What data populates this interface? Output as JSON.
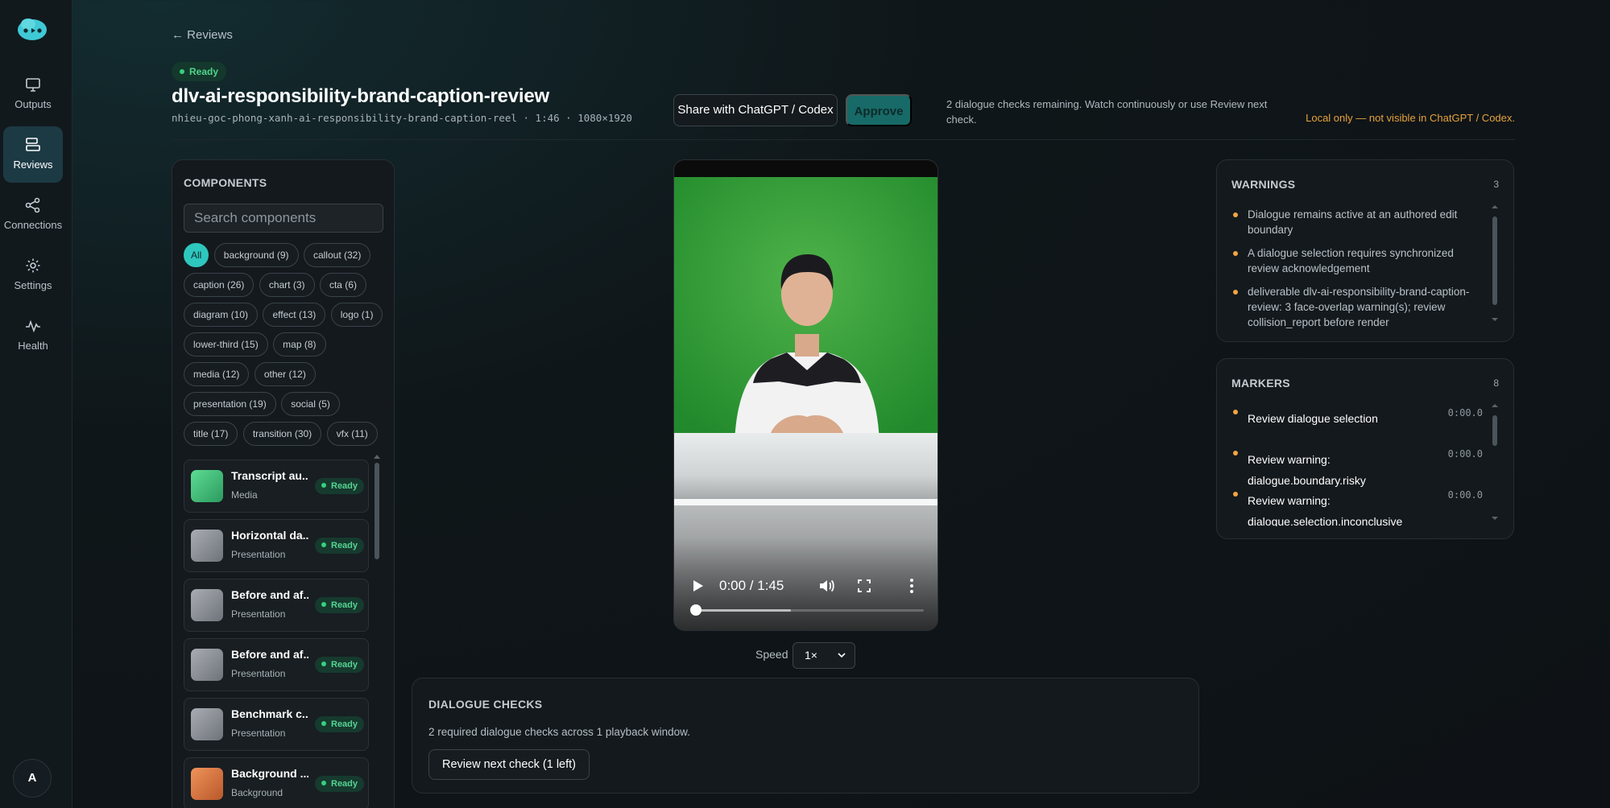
{
  "nav": {
    "items": [
      {
        "label": "Outputs",
        "icon": "monitor-icon"
      },
      {
        "label": "Reviews",
        "icon": "reviews-icon",
        "active": true
      },
      {
        "label": "Connections",
        "icon": "share-icon"
      },
      {
        "label": "Settings",
        "icon": "gear-icon"
      },
      {
        "label": "Health",
        "icon": "pulse-icon"
      }
    ],
    "avatar": "A"
  },
  "header": {
    "back": "← Reviews",
    "status": "Ready",
    "title": "dlv-ai-responsibility-brand-caption-review",
    "subtitle": "nhieu-goc-phong-xanh-ai-responsibility-brand-caption-reel · 1:46 · 1080×1920",
    "share_label": "Share with ChatGPT / Codex",
    "approve_label": "Approve",
    "checks_remaining": "2 dialogue checks remaining. Watch continuously or use Review next check.",
    "local_only": "Local only — not visible in ChatGPT / Codex."
  },
  "components": {
    "heading": "COMPONENTS",
    "search_placeholder": "Search components",
    "chips": [
      "All",
      "background (9)",
      "callout (32)",
      "caption (26)",
      "chart (3)",
      "cta (6)",
      "diagram (10)",
      "effect (13)",
      "logo (1)",
      "lower-third (15)",
      "map (8)",
      "media (12)",
      "other (12)",
      "presentation (19)",
      "social (5)",
      "title (17)",
      "transition (30)",
      "vfx (11)"
    ],
    "items": [
      {
        "name": "Transcript au...",
        "type": "Media",
        "status": "Ready"
      },
      {
        "name": "Horizontal da...",
        "type": "Presentation",
        "status": "Ready"
      },
      {
        "name": "Before and af...",
        "type": "Presentation",
        "status": "Ready"
      },
      {
        "name": "Before and af...",
        "type": "Presentation",
        "status": "Ready"
      },
      {
        "name": "Benchmark c...",
        "type": "Presentation",
        "status": "Ready"
      },
      {
        "name": "Background ...",
        "type": "Background",
        "status": "Ready"
      }
    ]
  },
  "player": {
    "time": "0:00 / 1:45",
    "progress": 0,
    "buffered": 0.42,
    "speed_label": "Speed",
    "speed_value": "1×"
  },
  "dialogue": {
    "heading": "DIALOGUE CHECKS",
    "description": "2 required dialogue checks across 1 playback window.",
    "button": "Review next check (1 left)"
  },
  "warnings": {
    "heading": "WARNINGS",
    "count": "3",
    "items": [
      "Dialogue remains active at an authored edit boundary",
      "A dialogue selection requires synchronized review acknowledgement",
      "deliverable dlv-ai-responsibility-brand-caption-review: 3 face-overlap warning(s); review collision_report before render"
    ]
  },
  "markers": {
    "heading": "MARKERS",
    "count": "8",
    "items": [
      {
        "label": "Review dialogue selection",
        "time": "0:00.0"
      },
      {
        "label": "Review warning: dialogue.boundary.risky",
        "time": "0:00.0"
      },
      {
        "label": "Review warning: dialogue.selection.inconclusive",
        "time": "0:00.0"
      }
    ]
  },
  "colors": {
    "accent": "#2ec7be",
    "ready": "#36d17f",
    "warning_dot": "#f2a541",
    "local_only": "#e6a23c",
    "approve": "#176a67"
  }
}
